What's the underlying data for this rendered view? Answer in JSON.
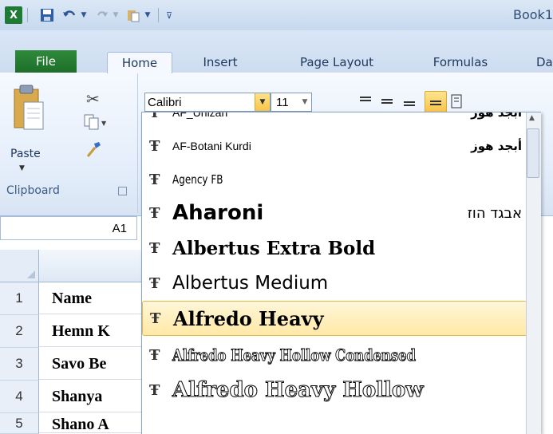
{
  "title_bar": {
    "book_title": "Book1"
  },
  "quick_access": {
    "icons": [
      "excel-logo-icon",
      "save-icon",
      "undo-icon",
      "undo-dropdown-icon",
      "redo-icon",
      "redo-dropdown-icon",
      "paste-qa-icon",
      "customize-qa-icon"
    ]
  },
  "tabs": {
    "file": "File",
    "home": "Home",
    "insert": "Insert",
    "page_layout": "Page Layout",
    "formulas": "Formulas",
    "data_partial": "Da"
  },
  "clipboard": {
    "paste": "Paste",
    "group_label": "Clipboard"
  },
  "font": {
    "name": "Calibri",
    "size": "11"
  },
  "name_box": {
    "value": "A1"
  },
  "rows": [
    {
      "num": "1",
      "value": "Name"
    },
    {
      "num": "2",
      "value": "Hemn K"
    },
    {
      "num": "3",
      "value": "Savo Be"
    },
    {
      "num": "4",
      "value": "Shanya"
    },
    {
      "num": "5",
      "value": "Shano A"
    }
  ],
  "font_list": [
    {
      "name": "AF_Unizan",
      "sample": "أبجد هوز"
    },
    {
      "name": "AF-Botani Kurdi",
      "sample": "أبجد هوز"
    },
    {
      "name": "Agency FB",
      "sample": ""
    },
    {
      "name": "Aharoni",
      "sample": "אבגד הוז"
    },
    {
      "name": "Albertus Extra Bold",
      "sample": ""
    },
    {
      "name": "Albertus Medium",
      "sample": ""
    },
    {
      "name": "Alfredo Heavy",
      "sample": "",
      "selected": true
    },
    {
      "name": "Alfredo Heavy Hollow Condensed",
      "sample": ""
    },
    {
      "name": "Alfredo Heavy Hollow",
      "sample": ""
    }
  ],
  "colors": {
    "file_tab": "#217a32",
    "highlight": "#ffe9a6",
    "ribbon": "#e3edfa"
  }
}
